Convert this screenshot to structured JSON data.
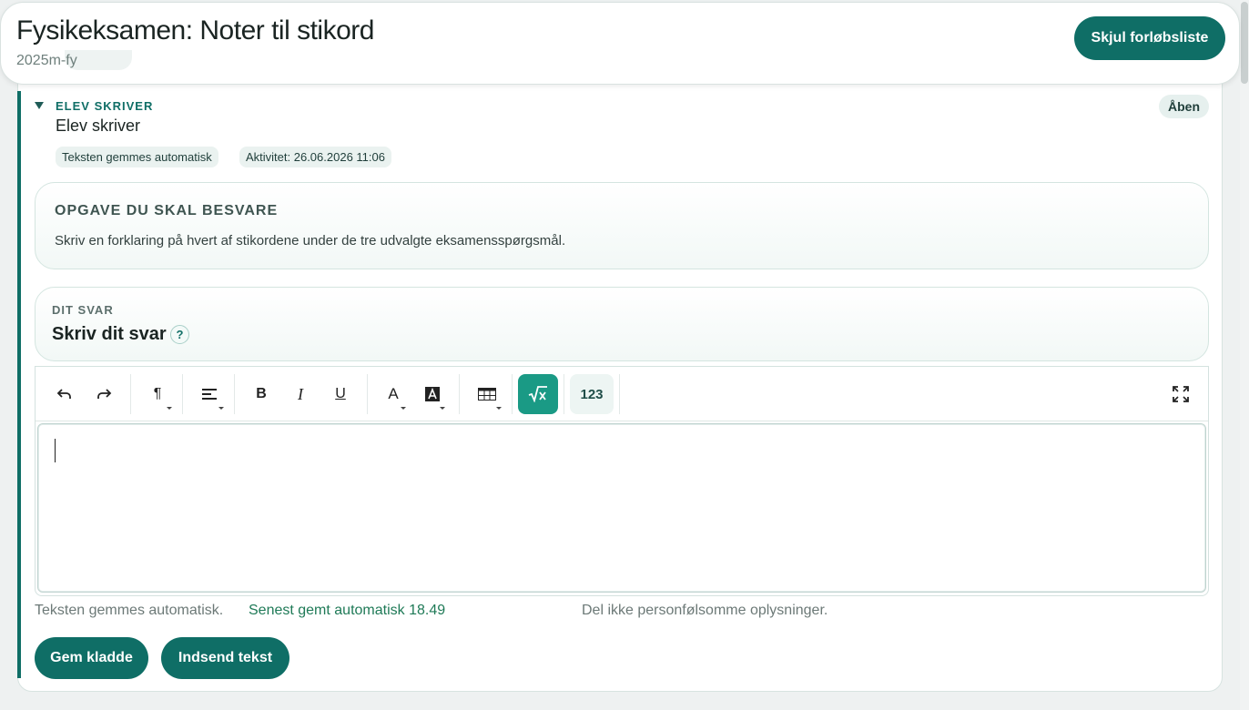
{
  "header": {
    "title": "Fysikeksamen: Noter til stikord",
    "subtitle": "2025m-fy",
    "hide_list_label": "Skjul forløbsliste"
  },
  "card": {
    "eyebrow": "ELEV SKRIVER",
    "title": "Elev skriver",
    "status": "Åben",
    "chips": [
      "Teksten gemmes automatisk",
      "Aktivitet: 26.06.2026 11:06"
    ]
  },
  "task": {
    "heading": "OPGAVE DU SKAL BESVARE",
    "text": "Skriv en forklaring på hvert af stikordene under de tre udvalgte eksamensspørgsmål."
  },
  "answer": {
    "eyebrow": "DIT SVAR",
    "title": "Skriv dit svar",
    "help": "?"
  },
  "toolbar": {
    "bold": "B",
    "italic": "I",
    "underline": "U",
    "font_color": "A",
    "paragraph": "¶",
    "numbers": "123",
    "icons": [
      "undo-icon",
      "redo-icon",
      "paragraph-icon",
      "align-icon",
      "bold-icon",
      "italic-icon",
      "underline-icon",
      "font-color-icon",
      "highlight-icon",
      "table-icon",
      "math-icon",
      "numbers-icon",
      "fullscreen-icon"
    ]
  },
  "footer": {
    "autosave": "Teksten gemmes automatisk.",
    "last_saved": "Senest gemt automatisk 18.49",
    "privacy": "Del ikke personfølsomme oplysninger.",
    "save_draft": "Gem kladde",
    "submit": "Indsend tekst"
  },
  "colors": {
    "primary": "#0f6e66",
    "math_button": "#1a9a85",
    "saved_text": "#1f7a57"
  }
}
